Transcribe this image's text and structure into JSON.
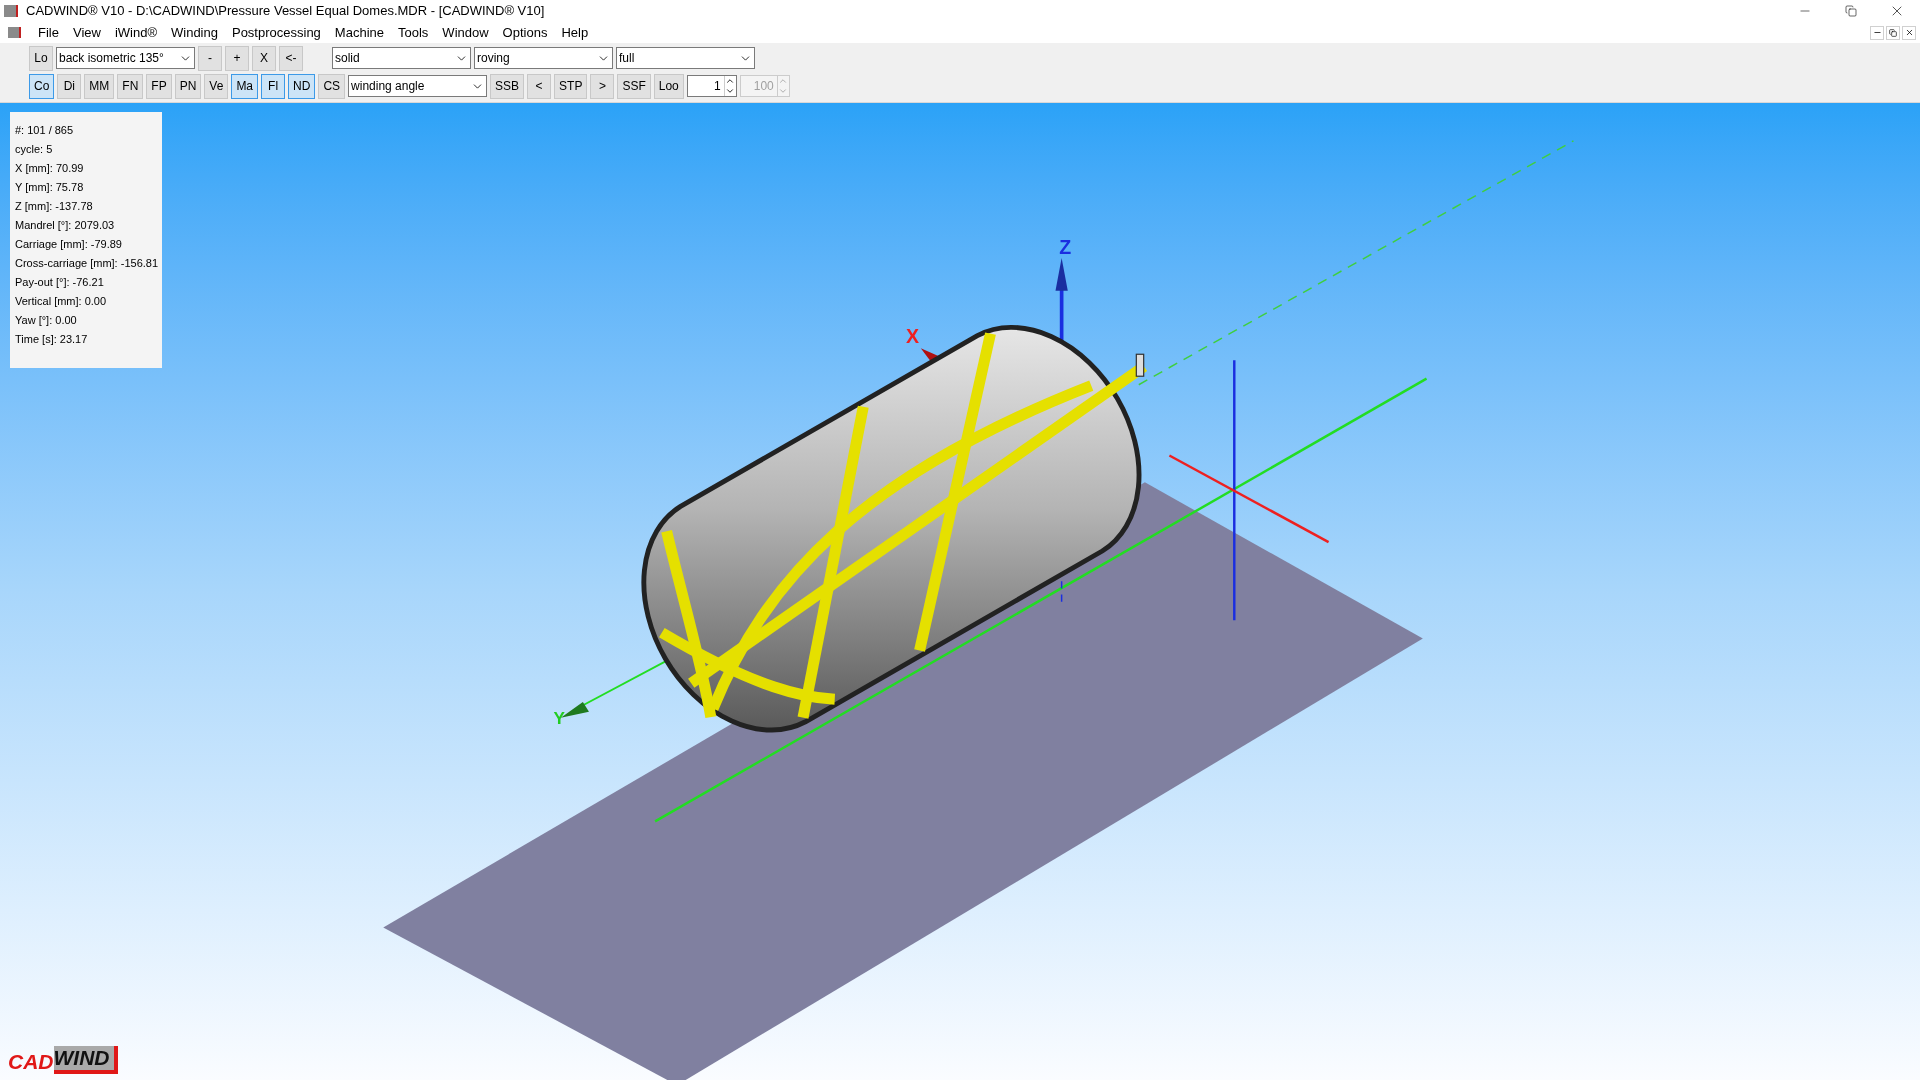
{
  "window": {
    "title": "CADWIND® V10  -  D:\\CADWIND\\Pressure Vessel Equal Domes.MDR - [CADWIND® V10]"
  },
  "menu": [
    "File",
    "View",
    "iWind®",
    "Winding",
    "Postprocessing",
    "Machine",
    "Tools",
    "Window",
    "Options",
    "Help"
  ],
  "toolbar_row_1": [
    {
      "kind": "button",
      "label": "Lo",
      "selected": false
    },
    {
      "kind": "combo",
      "value": "back isometric 135°"
    },
    {
      "kind": "button",
      "label": "-",
      "selected": false
    },
    {
      "kind": "button",
      "label": "+",
      "selected": false
    },
    {
      "kind": "button",
      "label": "X",
      "selected": false
    },
    {
      "kind": "button",
      "label": "<-",
      "selected": false
    },
    {
      "kind": "combo",
      "value": "solid"
    },
    {
      "kind": "combo",
      "value": "roving"
    },
    {
      "kind": "combo",
      "value": "full"
    }
  ],
  "toolbar_row_2": [
    {
      "kind": "button",
      "label": "Co",
      "selected": true
    },
    {
      "kind": "button",
      "label": "Di",
      "selected": false
    },
    {
      "kind": "button",
      "label": "MM",
      "selected": false
    },
    {
      "kind": "button",
      "label": "FN",
      "selected": false
    },
    {
      "kind": "button",
      "label": "FP",
      "selected": false
    },
    {
      "kind": "button",
      "label": "PN",
      "selected": false
    },
    {
      "kind": "button",
      "label": "Ve",
      "selected": false
    },
    {
      "kind": "button",
      "label": "Ma",
      "selected": true
    },
    {
      "kind": "button",
      "label": "Fl",
      "selected": true
    },
    {
      "kind": "button",
      "label": "ND",
      "selected": true
    },
    {
      "kind": "button",
      "label": "CS",
      "selected": false
    },
    {
      "kind": "combo",
      "value": "winding angle"
    },
    {
      "kind": "button",
      "label": "SSB",
      "selected": false
    },
    {
      "kind": "button",
      "label": "<",
      "selected": false
    },
    {
      "kind": "button",
      "label": "STP",
      "selected": false
    },
    {
      "kind": "button",
      "label": ">",
      "selected": false
    },
    {
      "kind": "button",
      "label": "SSF",
      "selected": false
    },
    {
      "kind": "button",
      "label": "Loo",
      "selected": false
    },
    {
      "kind": "spin",
      "value": "1",
      "disabled": false
    },
    {
      "kind": "spin",
      "value": "100",
      "disabled": true
    }
  ],
  "info_panel": [
    "#: 101 / 865",
    "cycle: 5",
    "X [mm]: 70.99",
    "Y [mm]: 75.78",
    "Z [mm]: -137.78",
    "Mandrel [°]: 2079.03",
    "Carriage [mm]: -79.89",
    "Cross-carriage [mm]: -156.81",
    "Pay-out [°]: -76.21",
    "Vertical [mm]: 0.00",
    "Yaw [°]: 0.00",
    "Time [s]: 23.17"
  ],
  "axis_labels": {
    "x": "X",
    "y": "Y",
    "z": "Z"
  },
  "logo": {
    "part_1": "CAD",
    "part_2": "WIND"
  }
}
